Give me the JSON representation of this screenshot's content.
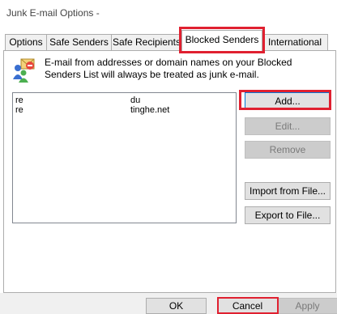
{
  "window": {
    "title": "Junk E-mail Options -"
  },
  "tabs": [
    {
      "label": "Options"
    },
    {
      "label": "Safe Senders"
    },
    {
      "label": "Safe Recipients"
    },
    {
      "label": "Blocked Senders",
      "active": true
    },
    {
      "label": "International"
    }
  ],
  "description": "E-mail from addresses or domain names on your Blocked Senders List will always be treated as junk e-mail.",
  "list": {
    "rows": [
      {
        "col1": "re",
        "col2": "du"
      },
      {
        "col1": "re",
        "col2": "tinghe.net"
      }
    ]
  },
  "buttons": {
    "add": "Add...",
    "edit": "Edit...",
    "remove": "Remove",
    "import": "Import from File...",
    "export": "Export to File..."
  },
  "footer": {
    "ok": "OK",
    "cancel": "Cancel",
    "apply": "Apply"
  },
  "colors": {
    "highlight": "#e02030",
    "focus": "#0078d7"
  }
}
